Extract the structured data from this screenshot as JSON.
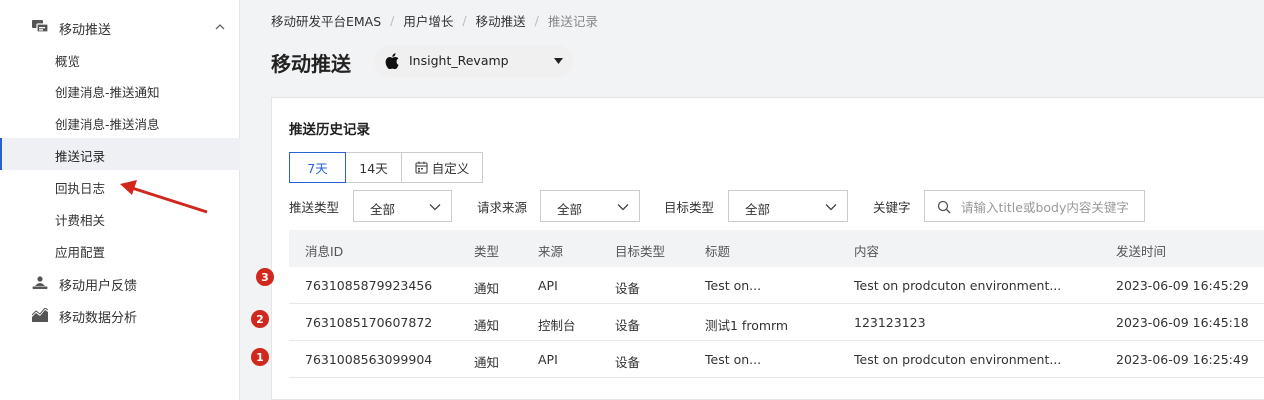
{
  "sidebar": {
    "group_push": "移动推送",
    "items": [
      {
        "label": "概览"
      },
      {
        "label": "创建消息-推送通知"
      },
      {
        "label": "创建消息-推送消息"
      },
      {
        "label": "推送记录",
        "active": true
      },
      {
        "label": "回执日志"
      },
      {
        "label": "计费相关"
      },
      {
        "label": "应用配置"
      }
    ],
    "group_feedback": "移动用户反馈",
    "group_analytics": "移动数据分析"
  },
  "breadcrumb": [
    "移动研发平台EMAS",
    "用户增长",
    "移动推送",
    "推送记录"
  ],
  "page_title": "移动推送",
  "app_selector": {
    "name": "Insight_Revamp",
    "icon": "apple-icon"
  },
  "card": {
    "title": "推送历史记录",
    "ranges": [
      "7天",
      "14天",
      "自定义"
    ],
    "filters": {
      "push_type_label": "推送类型",
      "push_type_value": "全部",
      "source_label": "请求来源",
      "source_value": "全部",
      "target_label": "目标类型",
      "target_value": "全部",
      "keyword_label": "关键字",
      "keyword_placeholder": "请输入title或body内容关键字"
    },
    "table": {
      "headers": [
        "消息ID",
        "类型",
        "来源",
        "目标类型",
        "标题",
        "内容",
        "发送时间"
      ],
      "rows": [
        [
          "7631085879923456",
          "通知",
          "API",
          "设备",
          "Test on...",
          "Test on prodcuton environment...",
          "2023-06-09 16:45:29"
        ],
        [
          "7631085170607872",
          "通知",
          "控制台",
          "设备",
          "测试1 fromrm",
          "123123123",
          "2023-06-09 16:45:18"
        ],
        [
          "7631008563099904",
          "通知",
          "API",
          "设备",
          "Test on...",
          "Test on prodcuton environment...",
          "2023-06-09 16:25:49"
        ]
      ]
    }
  },
  "annotations": {
    "badges": [
      "3",
      "2",
      "1"
    ],
    "color": "#d0281c"
  },
  "colors": {
    "accent": "#2a60d6",
    "annotation_red": "#d0281c"
  }
}
